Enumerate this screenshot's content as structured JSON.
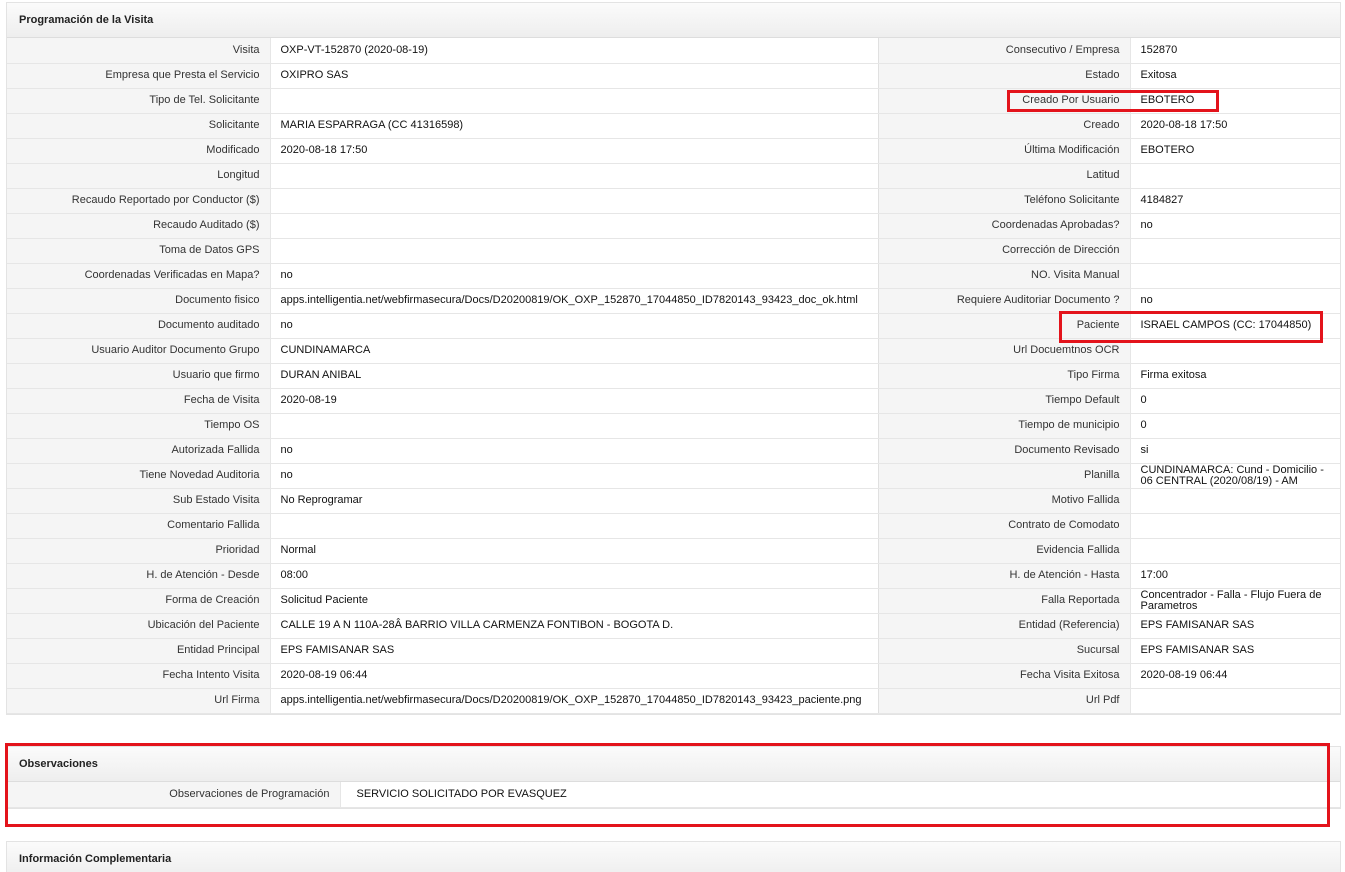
{
  "programacion": {
    "title": "Programación de la Visita",
    "rows": [
      {
        "l1": "Visita",
        "v1": " OXP-VT-152870 (2020-08-19)",
        "l2": "Consecutivo / Empresa",
        "v2": " 152870"
      },
      {
        "l1": "Empresa que Presta el Servicio",
        "v1": "OXIPRO SAS",
        "l2": "Estado",
        "v2": " Exitosa"
      },
      {
        "l1": "Tipo de Tel. Solicitante",
        "v1": "",
        "l2": "Creado Por Usuario",
        "v2": " EBOTERO"
      },
      {
        "l1": "Solicitante",
        "v1": "MARIA ESPARRAGA (CC 41316598)",
        "l2": "Creado",
        "v2": "2020-08-18 17:50"
      },
      {
        "l1": "Modificado",
        "v1": "2020-08-18 17:50",
        "l2": "Última Modificación",
        "v2": "EBOTERO"
      },
      {
        "l1": "Longitud",
        "v1": "",
        "l2": "Latitud",
        "v2": ""
      },
      {
        "l1": "Recaudo Reportado por Conductor ($)",
        "v1": "",
        "l2": "Teléfono Solicitante",
        "v2": " 4184827"
      },
      {
        "l1": "Recaudo Auditado ($)",
        "v1": "",
        "l2": "Coordenadas Aprobadas?",
        "v2": "no"
      },
      {
        "l1": "Toma de Datos GPS",
        "v1": "",
        "l2": "Corrección de Dirección",
        "v2": ""
      },
      {
        "l1": "Coordenadas Verificadas en Mapa?",
        "v1": "no",
        "l2": "NO. Visita Manual",
        "v2": ""
      },
      {
        "l1": "Documento fisico",
        "v1": "apps.intelligentia.net/webfirmasecura/Docs/D20200819/OK_OXP_152870_17044850_ID7820143_93423_doc_ok.html",
        "l2": "Requiere Auditoriar Documento ?",
        "v2": "no"
      },
      {
        "l1": "Documento auditado",
        "v1": "no",
        "l2": "Paciente",
        "v2": "ISRAEL CAMPOS (CC: 17044850)"
      },
      {
        "l1": "Usuario Auditor Documento Grupo",
        "v1": " CUNDINAMARCA",
        "l2": "Url Docuemtnos OCR",
        "v2": ""
      },
      {
        "l1": "Usuario que firmo",
        "v1": "DURAN ANIBAL",
        "l2": "Tipo Firma",
        "v2": " Firma exitosa"
      },
      {
        "l1": "Fecha de Visita",
        "v1": "2020-08-19",
        "l2": "Tiempo Default",
        "v2": " 0"
      },
      {
        "l1": "Tiempo OS",
        "v1": "",
        "l2": "Tiempo de municipio",
        "v2": " 0"
      },
      {
        "l1": "Autorizada Fallida",
        "v1": "no",
        "l2": "Documento Revisado",
        "v2": "si"
      },
      {
        "l1": "Tiene Novedad Auditoria",
        "v1": "no",
        "l2": "Planilla",
        "v2": "CUNDINAMARCA: Cund - Domicilio - 06 CENTRAL (2020/08/19) - AM"
      },
      {
        "l1": "Sub Estado Visita",
        "v1": " No Reprogramar",
        "l2": "Motivo Fallida",
        "v2": ""
      },
      {
        "l1": "Comentario Fallida",
        "v1": "",
        "l2": "Contrato de Comodato",
        "v2": ""
      },
      {
        "l1": "Prioridad",
        "v1": " Normal",
        "l2": "Evidencia Fallida",
        "v2": ""
      },
      {
        "l1": "H. de Atención - Desde",
        "v1": " 08:00",
        "l2": "H. de Atención - Hasta",
        "v2": " 17:00"
      },
      {
        "l1": "Forma de Creación",
        "v1": " Solicitud Paciente",
        "l2": "Falla Reportada",
        "v2": " Concentrador - Falla - Flujo Fuera de Parametros"
      },
      {
        "l1": "Ubicación del Paciente",
        "v1": "CALLE 19 A N 110A-28Â BARRIO VILLA CARMENZA FONTIBON - BOGOTA D.",
        "l2": "Entidad (Referencia)",
        "v2": "EPS FAMISANAR SAS"
      },
      {
        "l1": "Entidad Principal",
        "v1": " EPS FAMISANAR SAS",
        "l2": "Sucursal",
        "v2": " EPS FAMISANAR SAS"
      },
      {
        "l1": "Fecha Intento Visita",
        "v1": "2020-08-19 06:44",
        "l2": "Fecha Visita Exitosa",
        "v2": "2020-08-19 06:44"
      },
      {
        "l1": "Url Firma",
        "v1": " apps.intelligentia.net/webfirmasecura/Docs/D20200819/OK_OXP_152870_17044850_ID7820143_93423_paciente.png",
        "l2": "Url Pdf",
        "v2": ""
      }
    ]
  },
  "observaciones": {
    "title": "Observaciones",
    "label": "Observaciones de Programación",
    "value": "SERVICIO SOLICITADO POR EVASQUEZ"
  },
  "complementaria": {
    "title": "Información Complementaria"
  },
  "colors": {
    "highlight": "#e3131b",
    "label_bg": "#f5f5f5"
  }
}
